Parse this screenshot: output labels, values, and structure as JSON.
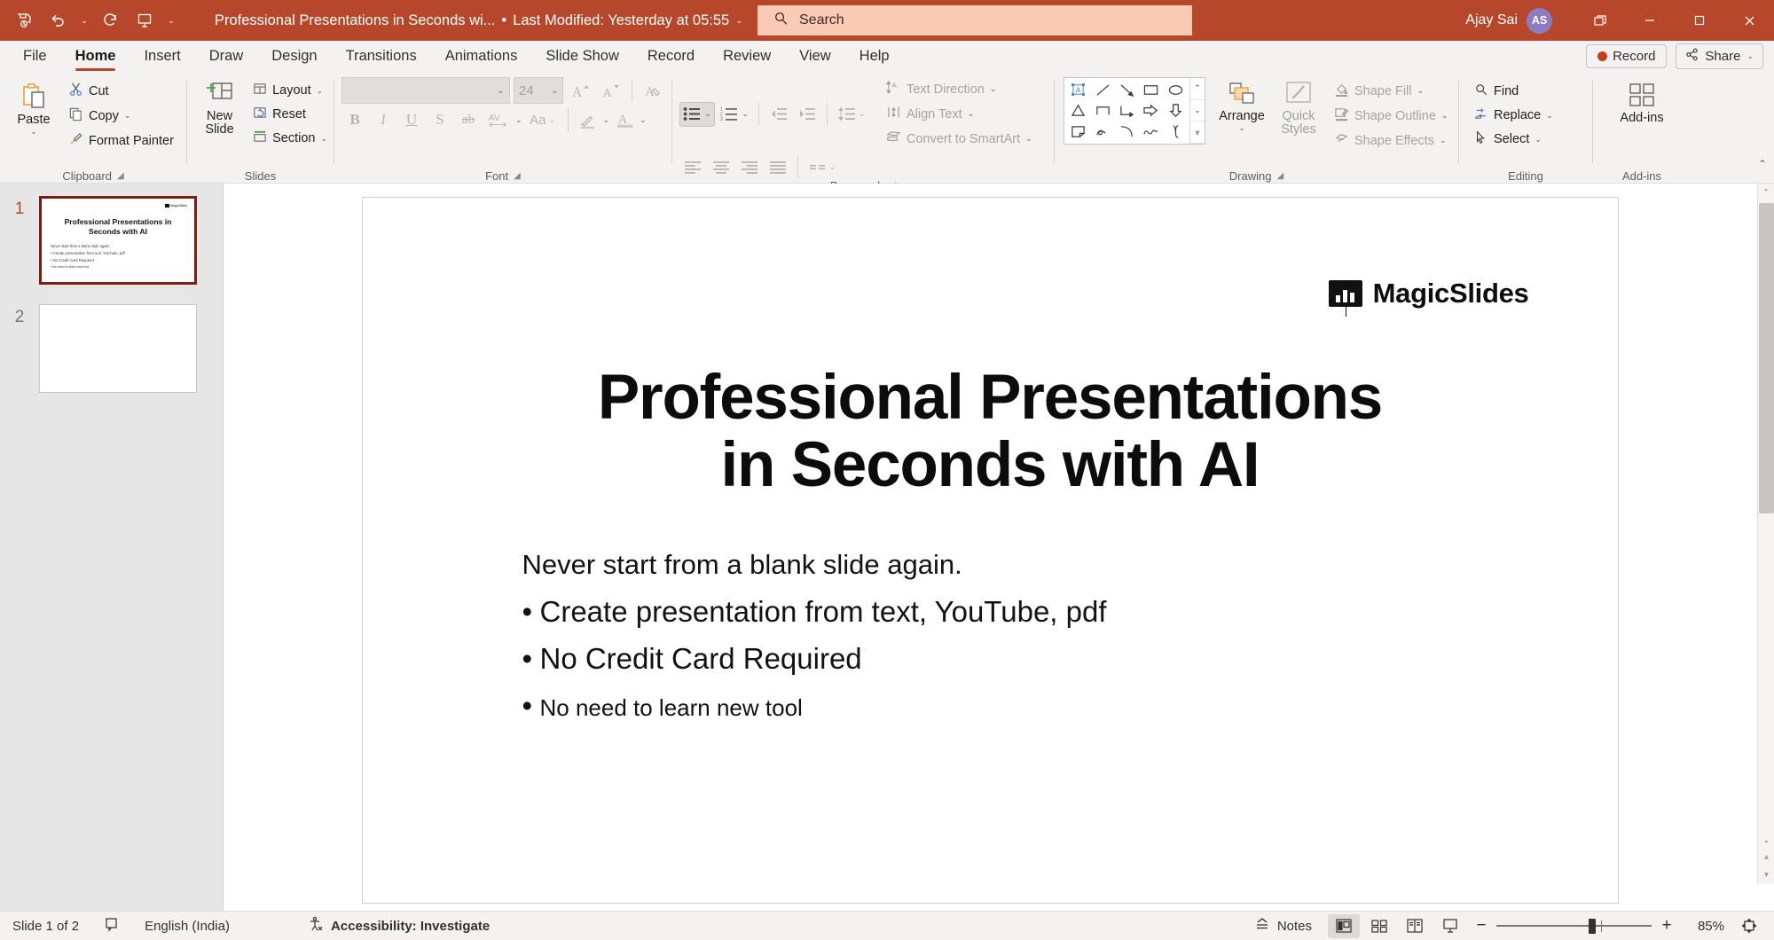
{
  "titlebar": {
    "quick_access": [
      {
        "name": "save-icon",
        "label": "Save"
      },
      {
        "name": "undo-icon",
        "label": "Undo"
      },
      {
        "name": "redo-icon",
        "label": "Redo"
      },
      {
        "name": "start-presentation-icon",
        "label": "Start from Beginning"
      }
    ],
    "customize_caret": "⌄",
    "document_title": "Professional Presentations in Seconds wi...",
    "separator": "•",
    "last_modified": "Last Modified: Yesterday at 05:55",
    "title_caret": "⌄",
    "search_placeholder": "Search",
    "account_name": "Ajay Sai",
    "avatar_initials": "AS",
    "window_buttons": [
      "restore-down",
      "minimize",
      "maximize",
      "close"
    ]
  },
  "tabs": [
    {
      "label": "File",
      "active": false
    },
    {
      "label": "Home",
      "active": true
    },
    {
      "label": "Insert",
      "active": false
    },
    {
      "label": "Draw",
      "active": false
    },
    {
      "label": "Design",
      "active": false
    },
    {
      "label": "Transitions",
      "active": false
    },
    {
      "label": "Animations",
      "active": false
    },
    {
      "label": "Slide Show",
      "active": false
    },
    {
      "label": "Record",
      "active": false
    },
    {
      "label": "Review",
      "active": false
    },
    {
      "label": "View",
      "active": false
    },
    {
      "label": "Help",
      "active": false
    }
  ],
  "tabstrip_right": {
    "record_label": "Record",
    "share_label": "Share",
    "share_caret": "⌄"
  },
  "ribbon": {
    "clipboard": {
      "group_label": "Clipboard",
      "paste_label": "Paste",
      "paste_caret": "⌄",
      "cut_label": "Cut",
      "copy_label": "Copy",
      "copy_caret": "⌄",
      "format_painter_label": "Format Painter"
    },
    "slides": {
      "group_label": "Slides",
      "new_slide_label_1": "New",
      "new_slide_label_2": "Slide",
      "new_slide_caret": "⌄",
      "layout_label": "Layout",
      "layout_caret": "⌄",
      "reset_label": "Reset",
      "section_label": "Section",
      "section_caret": "⌄"
    },
    "font": {
      "group_label": "Font",
      "font_name_value": "",
      "font_size_value": "24",
      "bold": "B",
      "italic": "I",
      "underline": "U",
      "shadow": "S",
      "strikethrough": "ab",
      "character_spacing": "AV",
      "change_case": "Aa",
      "increase_size": "A",
      "decrease_size": "A",
      "clear_formatting": "A",
      "text_highlight": "highlight",
      "font_color": "A"
    },
    "paragraph": {
      "group_label": "Paragraph",
      "text_direction_label": "Text Direction",
      "align_text_label": "Align Text",
      "convert_smartart_label": "Convert to SmartArt"
    },
    "drawing": {
      "group_label": "Drawing",
      "arrange_label": "Arrange",
      "arrange_caret": "⌄",
      "quick_styles_label_1": "Quick",
      "quick_styles_label_2": "Styles",
      "quick_styles_caret": "⌄",
      "shape_fill_label": "Shape Fill",
      "shape_outline_label": "Shape Outline",
      "shape_effects_label": "Shape Effects"
    },
    "editing": {
      "group_label": "Editing",
      "find_label": "Find",
      "replace_label": "Replace",
      "replace_caret": "⌄",
      "select_label": "Select",
      "select_caret": "⌄"
    },
    "addins": {
      "group_label": "Add-ins",
      "addins_label": "Add-ins"
    },
    "collapse_caret": "⌃"
  },
  "thumbnails": [
    {
      "number": "1",
      "selected": true,
      "logo_text": "MagicSlides",
      "title": "Professional Presentations in Seconds with AI",
      "lines": [
        "Never start from a blank slide again.",
        "• Create presentation from text, YouTube, pdf",
        "• No Credit Card Required",
        "• No need to learn new tool"
      ]
    },
    {
      "number": "2",
      "selected": false,
      "logo_text": "",
      "title": "",
      "lines": []
    }
  ],
  "slide": {
    "logo_text": "MagicSlides",
    "title_line_1": "Professional Presentations",
    "title_line_2": "in Seconds with AI",
    "body": [
      {
        "text": "Never start from a blank slide again.",
        "bullet": false,
        "size": "normal"
      },
      {
        "text": "Create presentation from text, YouTube, pdf",
        "bullet": true,
        "size": "large"
      },
      {
        "text": "No Credit Card Required",
        "bullet": true,
        "size": "large"
      },
      {
        "text": "No need to learn new tool",
        "bullet": true,
        "size": "small"
      }
    ]
  },
  "statusbar": {
    "slide_indicator": "Slide 1 of 2",
    "language": "English (India)",
    "accessibility": "Accessibility: Investigate",
    "notes_label": "Notes",
    "zoom_minus": "−",
    "zoom_plus": "+",
    "zoom_percent": "85%",
    "views": [
      "normal-view",
      "slide-sorter-view",
      "reading-view",
      "slide-show-view"
    ]
  }
}
